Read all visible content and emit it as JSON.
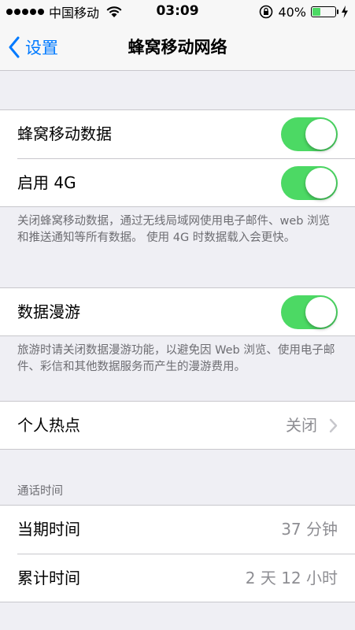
{
  "status_bar": {
    "signal_dots": 5,
    "carrier": "中国移动",
    "time": "03:09",
    "battery_percent_text": "40%",
    "battery_level": 0.4,
    "accent_green": "#4cd964"
  },
  "nav": {
    "back_label": "设置",
    "title": "蜂窝移动网络",
    "tint": "#007aff"
  },
  "cellular_group": {
    "cellular_data": {
      "label": "蜂窝移动数据",
      "on": true
    },
    "enable_4g": {
      "label": "启用 4G",
      "on": true
    },
    "footer": "关闭蜂窝移动数据，通过无线局域网使用电子邮件、web 浏览和推送通知等所有数据。 使用 4G 时数据载入会更快。"
  },
  "roaming_group": {
    "data_roaming": {
      "label": "数据漫游",
      "on": true
    },
    "footer": "旅游时请关闭数据漫游功能，以避免因 Web 浏览、使用电子邮件、彩信和其他数据服务而产生的漫游费用。"
  },
  "hotspot": {
    "label": "个人热点",
    "value": "关闭"
  },
  "call_time": {
    "header": "通话时间",
    "current": {
      "label": "当期时间",
      "value": "37 分钟"
    },
    "total": {
      "label": "累计时间",
      "value": "2 天 12 小时"
    }
  }
}
